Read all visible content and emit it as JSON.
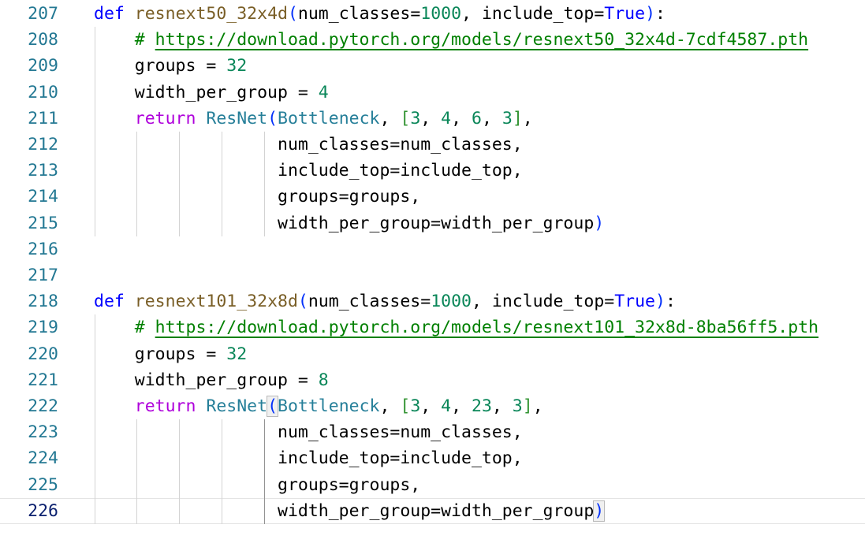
{
  "editor": {
    "language": "python",
    "current_line": "226",
    "lines": [
      {
        "no": "207",
        "tokens": [
          {
            "t": "def",
            "c": "kw-def"
          },
          {
            "t": " ",
            "c": ""
          },
          {
            "t": "resnext50_32x4d",
            "c": "fn"
          },
          {
            "t": "(",
            "c": "p1"
          },
          {
            "t": "num_classes",
            "c": ""
          },
          {
            "t": "=",
            "c": ""
          },
          {
            "t": "1000",
            "c": "num"
          },
          {
            "t": ", ",
            "c": ""
          },
          {
            "t": "include_top",
            "c": ""
          },
          {
            "t": "=",
            "c": ""
          },
          {
            "t": "True",
            "c": "kw-def"
          },
          {
            "t": ")",
            "c": "p1"
          },
          {
            "t": ":",
            "c": ""
          }
        ]
      },
      {
        "no": "208",
        "tokens": [
          {
            "t": "    ",
            "c": ""
          },
          {
            "t": "# ",
            "c": "cmt"
          },
          {
            "t": "https://download.pytorch.org/models/resnext50_32x4d-7cdf4587.pth",
            "c": "url"
          }
        ]
      },
      {
        "no": "209",
        "tokens": [
          {
            "t": "    ",
            "c": ""
          },
          {
            "t": "groups",
            "c": ""
          },
          {
            "t": " = ",
            "c": ""
          },
          {
            "t": "32",
            "c": "num"
          }
        ]
      },
      {
        "no": "210",
        "tokens": [
          {
            "t": "    ",
            "c": ""
          },
          {
            "t": "width_per_group",
            "c": ""
          },
          {
            "t": " = ",
            "c": ""
          },
          {
            "t": "4",
            "c": "num"
          }
        ]
      },
      {
        "no": "211",
        "tokens": [
          {
            "t": "    ",
            "c": ""
          },
          {
            "t": "return",
            "c": "kw-flow"
          },
          {
            "t": " ",
            "c": ""
          },
          {
            "t": "ResNet",
            "c": "cls"
          },
          {
            "t": "(",
            "c": "p1"
          },
          {
            "t": "Bottleneck",
            "c": "cls"
          },
          {
            "t": ", ",
            "c": ""
          },
          {
            "t": "[",
            "c": "p2"
          },
          {
            "t": "3",
            "c": "num"
          },
          {
            "t": ", ",
            "c": ""
          },
          {
            "t": "4",
            "c": "num"
          },
          {
            "t": ", ",
            "c": ""
          },
          {
            "t": "6",
            "c": "num"
          },
          {
            "t": ", ",
            "c": ""
          },
          {
            "t": "3",
            "c": "num"
          },
          {
            "t": "]",
            "c": "p2"
          },
          {
            "t": ",",
            "c": ""
          }
        ]
      },
      {
        "no": "212",
        "tokens": [
          {
            "t": "                  ",
            "c": ""
          },
          {
            "t": "num_classes=num_classes,",
            "c": ""
          }
        ]
      },
      {
        "no": "213",
        "tokens": [
          {
            "t": "                  ",
            "c": ""
          },
          {
            "t": "include_top=include_top,",
            "c": ""
          }
        ]
      },
      {
        "no": "214",
        "tokens": [
          {
            "t": "                  ",
            "c": ""
          },
          {
            "t": "groups=groups,",
            "c": ""
          }
        ]
      },
      {
        "no": "215",
        "tokens": [
          {
            "t": "                  ",
            "c": ""
          },
          {
            "t": "width_per_group=width_per_group",
            "c": ""
          },
          {
            "t": ")",
            "c": "p1"
          }
        ]
      },
      {
        "no": "216",
        "tokens": []
      },
      {
        "no": "217",
        "tokens": []
      },
      {
        "no": "218",
        "tokens": [
          {
            "t": "def",
            "c": "kw-def"
          },
          {
            "t": " ",
            "c": ""
          },
          {
            "t": "resnext101_32x8d",
            "c": "fn"
          },
          {
            "t": "(",
            "c": "p1"
          },
          {
            "t": "num_classes",
            "c": ""
          },
          {
            "t": "=",
            "c": ""
          },
          {
            "t": "1000",
            "c": "num"
          },
          {
            "t": ", ",
            "c": ""
          },
          {
            "t": "include_top",
            "c": ""
          },
          {
            "t": "=",
            "c": ""
          },
          {
            "t": "True",
            "c": "kw-def"
          },
          {
            "t": ")",
            "c": "p1"
          },
          {
            "t": ":",
            "c": ""
          }
        ]
      },
      {
        "no": "219",
        "tokens": [
          {
            "t": "    ",
            "c": ""
          },
          {
            "t": "# ",
            "c": "cmt"
          },
          {
            "t": "https://download.pytorch.org/models/resnext101_32x8d-8ba56ff5.pth",
            "c": "url"
          }
        ]
      },
      {
        "no": "220",
        "tokens": [
          {
            "t": "    ",
            "c": ""
          },
          {
            "t": "groups",
            "c": ""
          },
          {
            "t": " = ",
            "c": ""
          },
          {
            "t": "32",
            "c": "num"
          }
        ]
      },
      {
        "no": "221",
        "tokens": [
          {
            "t": "    ",
            "c": ""
          },
          {
            "t": "width_per_group",
            "c": ""
          },
          {
            "t": " = ",
            "c": ""
          },
          {
            "t": "8",
            "c": "num"
          }
        ]
      },
      {
        "no": "222",
        "tokens": [
          {
            "t": "    ",
            "c": ""
          },
          {
            "t": "return",
            "c": "kw-flow"
          },
          {
            "t": " ",
            "c": ""
          },
          {
            "t": "ResNet",
            "c": "cls"
          },
          {
            "t": "(",
            "c": "p1 bm"
          },
          {
            "t": "Bottleneck",
            "c": "cls"
          },
          {
            "t": ", ",
            "c": ""
          },
          {
            "t": "[",
            "c": "p2"
          },
          {
            "t": "3",
            "c": "num"
          },
          {
            "t": ", ",
            "c": ""
          },
          {
            "t": "4",
            "c": "num"
          },
          {
            "t": ", ",
            "c": ""
          },
          {
            "t": "23",
            "c": "num"
          },
          {
            "t": ", ",
            "c": ""
          },
          {
            "t": "3",
            "c": "num"
          },
          {
            "t": "]",
            "c": "p2"
          },
          {
            "t": ",",
            "c": ""
          }
        ]
      },
      {
        "no": "223",
        "tokens": [
          {
            "t": "                  ",
            "c": ""
          },
          {
            "t": "num_classes=num_classes,",
            "c": ""
          }
        ]
      },
      {
        "no": "224",
        "tokens": [
          {
            "t": "                  ",
            "c": ""
          },
          {
            "t": "include_top=include_top,",
            "c": ""
          }
        ]
      },
      {
        "no": "225",
        "tokens": [
          {
            "t": "                  ",
            "c": ""
          },
          {
            "t": "groups=groups,",
            "c": ""
          }
        ]
      },
      {
        "no": "226",
        "tokens": [
          {
            "t": "                  ",
            "c": ""
          },
          {
            "t": "width_per_group=width_per_group",
            "c": ""
          },
          {
            "t": ")",
            "c": "p1 bm"
          }
        ]
      }
    ]
  },
  "colors": {
    "background": "#ffffff",
    "line_number": "#237893",
    "line_number_active": "#0b216f",
    "keyword": "#0000ff",
    "control_keyword": "#af00db",
    "function": "#795e26",
    "class": "#267f99",
    "number": "#098658",
    "comment": "#008000",
    "bracket_1": "#0431fa",
    "bracket_2": "#319331"
  }
}
